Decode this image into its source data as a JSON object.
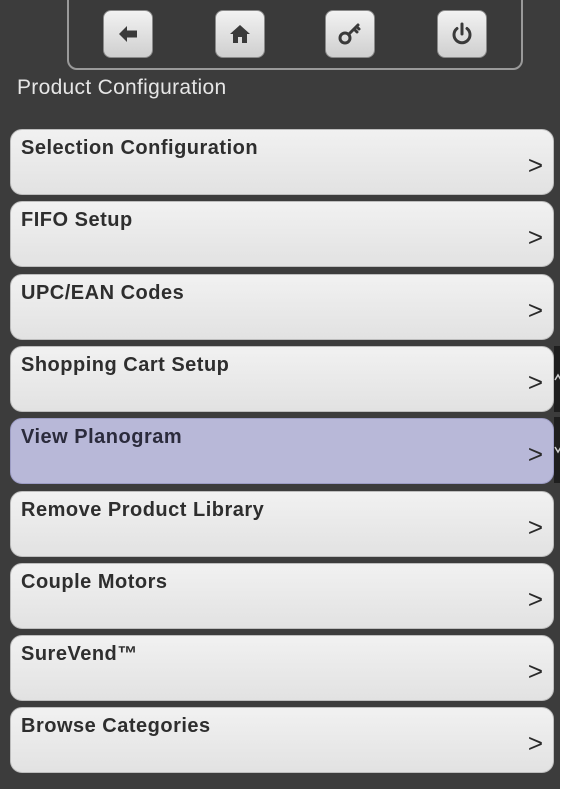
{
  "header": {
    "title": "Product Configuration",
    "buttons": [
      {
        "icon": "back-arrow-icon"
      },
      {
        "icon": "home-icon"
      },
      {
        "icon": "key-icon"
      },
      {
        "icon": "power-icon"
      }
    ]
  },
  "menu": {
    "items": [
      {
        "label": "Selection Configuration",
        "chevron": ">"
      },
      {
        "label": "FIFO Setup",
        "chevron": ">"
      },
      {
        "label": "UPC/EAN Codes",
        "chevron": ">"
      },
      {
        "label": "Shopping Cart Setup",
        "chevron": ">"
      },
      {
        "label": "View Planogram",
        "chevron": ">",
        "selected": true
      },
      {
        "label": "Remove Product Library",
        "chevron": ">"
      },
      {
        "label": "Couple Motors",
        "chevron": ">"
      },
      {
        "label": "SureVend™",
        "chevron": ">"
      },
      {
        "label": "Browse Categories",
        "chevron": ">"
      }
    ]
  },
  "colors": {
    "background": "#3c3c3c",
    "item_bg": "#e8e8e8",
    "selected_bg": "#b8b8d8"
  }
}
